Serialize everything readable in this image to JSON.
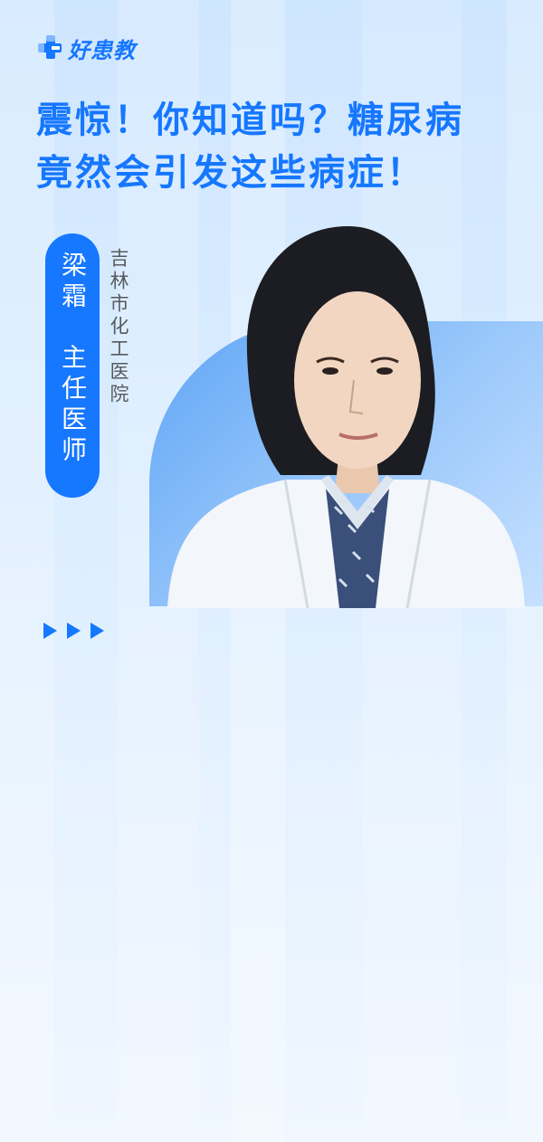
{
  "brand": {
    "name": "好患教",
    "icon": "medical-cross-logo-icon",
    "color": "#1677ff"
  },
  "title": {
    "line1": "震惊！你知道吗？糖尿病",
    "line2": "竟然会引发这些病症！"
  },
  "doctor": {
    "name": "梁霜",
    "title": "主任医师",
    "hospital": "吉林市化工医院"
  },
  "decor": {
    "arrows_icon": "triple-play-arrows-icon"
  },
  "colors": {
    "accent": "#1677ff",
    "background": "#d9ecff"
  }
}
